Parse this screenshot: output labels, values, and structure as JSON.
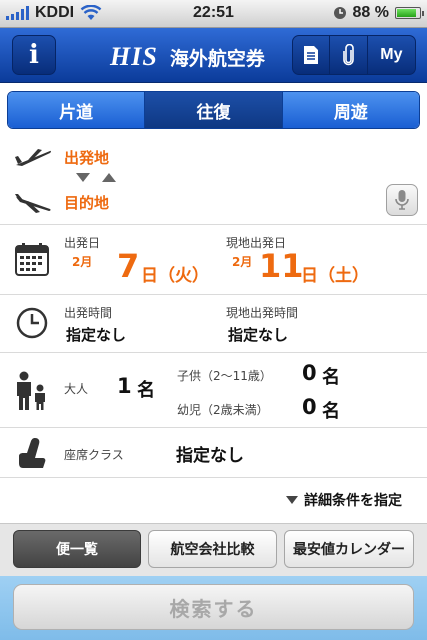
{
  "status": {
    "carrier": "KDDI",
    "time": "22:51",
    "battery": "88 %",
    "battery_level": 0.88
  },
  "header": {
    "info_label": "i",
    "brand": "HIS",
    "title": "海外航空券",
    "my_label": "My"
  },
  "trip_types": [
    {
      "label": "片道",
      "active": false
    },
    {
      "label": "往復",
      "active": true
    },
    {
      "label": "周遊",
      "active": false
    }
  ],
  "route": {
    "departure": "出発地",
    "destination": "目的地"
  },
  "dates": {
    "departure_label": "出発日",
    "departure_month": "2月",
    "departure_day": "7",
    "departure_suffix": "日（火）",
    "return_label": "現地出発日",
    "return_month": "2月",
    "return_day": "11",
    "return_suffix": "日（土）"
  },
  "times": {
    "departure_label": "出発時間",
    "departure_value": "指定なし",
    "return_label": "現地出発時間",
    "return_value": "指定なし"
  },
  "passengers": {
    "adult_label": "大人",
    "adult_count": "1",
    "unit": "名",
    "child_label": "子供（2〜11歳）",
    "child_count": "0",
    "infant_label": "幼児（2歳未満）",
    "infant_count": "0"
  },
  "seat": {
    "label": "座席クラス",
    "value": "指定なし"
  },
  "detail": {
    "label": "詳細条件を指定"
  },
  "result_tabs": [
    {
      "label": "便一覧",
      "active": true
    },
    {
      "label": "航空会社比較",
      "active": false
    },
    {
      "label": "最安値カレンダー",
      "active": false
    }
  ],
  "search": {
    "label": "検索する"
  },
  "colors": {
    "accent": "#ee6a10",
    "header": "#0b3b9a",
    "segment": "#1a5fd3"
  }
}
